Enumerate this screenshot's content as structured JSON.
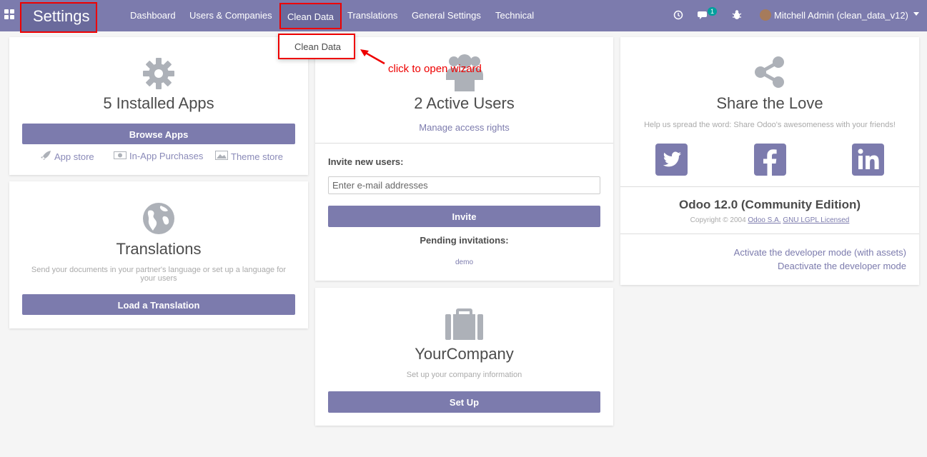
{
  "navbar": {
    "brand": "Settings",
    "menu": [
      "Dashboard",
      "Users & Companies",
      "Clean Data",
      "Translations",
      "General Settings",
      "Technical"
    ],
    "chat_badge": "1",
    "user": "Mitchell Admin (clean_data_v12)"
  },
  "dropdown": {
    "item": "Clean Data"
  },
  "annotation": "click to open wizard",
  "apps_card": {
    "title": "5 Installed Apps",
    "button": "Browse Apps",
    "links": [
      "App store",
      "In-App Purchases",
      "Theme store"
    ]
  },
  "translations_card": {
    "title": "Translations",
    "subtitle": "Send your documents in your partner's language or set up a language for your users",
    "button": "Load a Translation"
  },
  "users_card": {
    "title": "2 Active Users",
    "manage_link": "Manage access rights",
    "invite_label": "Invite new users:",
    "email_placeholder": "Enter e-mail addresses",
    "invite_button": "Invite",
    "pending_label": "Pending invitations:",
    "pending": [
      "demo"
    ]
  },
  "company_card": {
    "title": "YourCompany",
    "subtitle": "Set up your company information",
    "button": "Set Up"
  },
  "share_card": {
    "title": "Share the Love",
    "subtitle": "Help us spread the word: Share Odoo's awesomeness with your friends!",
    "social": [
      "twitter",
      "facebook",
      "linkedin"
    ],
    "edition": "Odoo 12.0 (Community Edition)",
    "copyright_prefix": "Copyright © 2004",
    "company_link": "Odoo S.A.",
    "license_link": "GNU LGPL Licensed",
    "dev_mode_assets": "Activate the developer mode (with assets)",
    "dev_mode_off": "Deactivate the developer mode"
  },
  "colors": {
    "primary": "#7c7bad",
    "highlight": "#ee0000",
    "icon_grey": "#adb1b8"
  }
}
